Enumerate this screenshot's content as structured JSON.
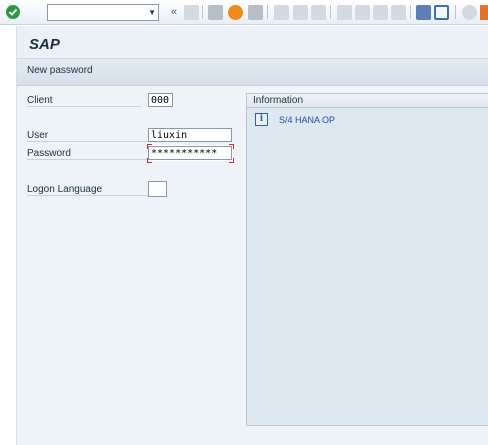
{
  "toolbar": {
    "command_field_value": "",
    "icons": [
      "enter-check-icon",
      "back-icon",
      "save-icon",
      "back-arrow-icon",
      "exit-icon",
      "cancel-icon",
      "print-icon",
      "find-icon",
      "find-next-icon",
      "first-page-icon",
      "previous-page-icon",
      "next-page-icon",
      "last-page-icon",
      "new-session-icon",
      "shortcut-icon",
      "help-icon"
    ]
  },
  "screen": {
    "title": "SAP",
    "new_password_button": "New password"
  },
  "form": {
    "client_label": "Client",
    "client_value": "000",
    "user_label": "User",
    "user_value": "liuxin",
    "password_label": "Password",
    "password_value": "***********",
    "language_label": "Logon Language",
    "language_value": ""
  },
  "info": {
    "header": "Information",
    "text": "S/4 HANA OP"
  }
}
